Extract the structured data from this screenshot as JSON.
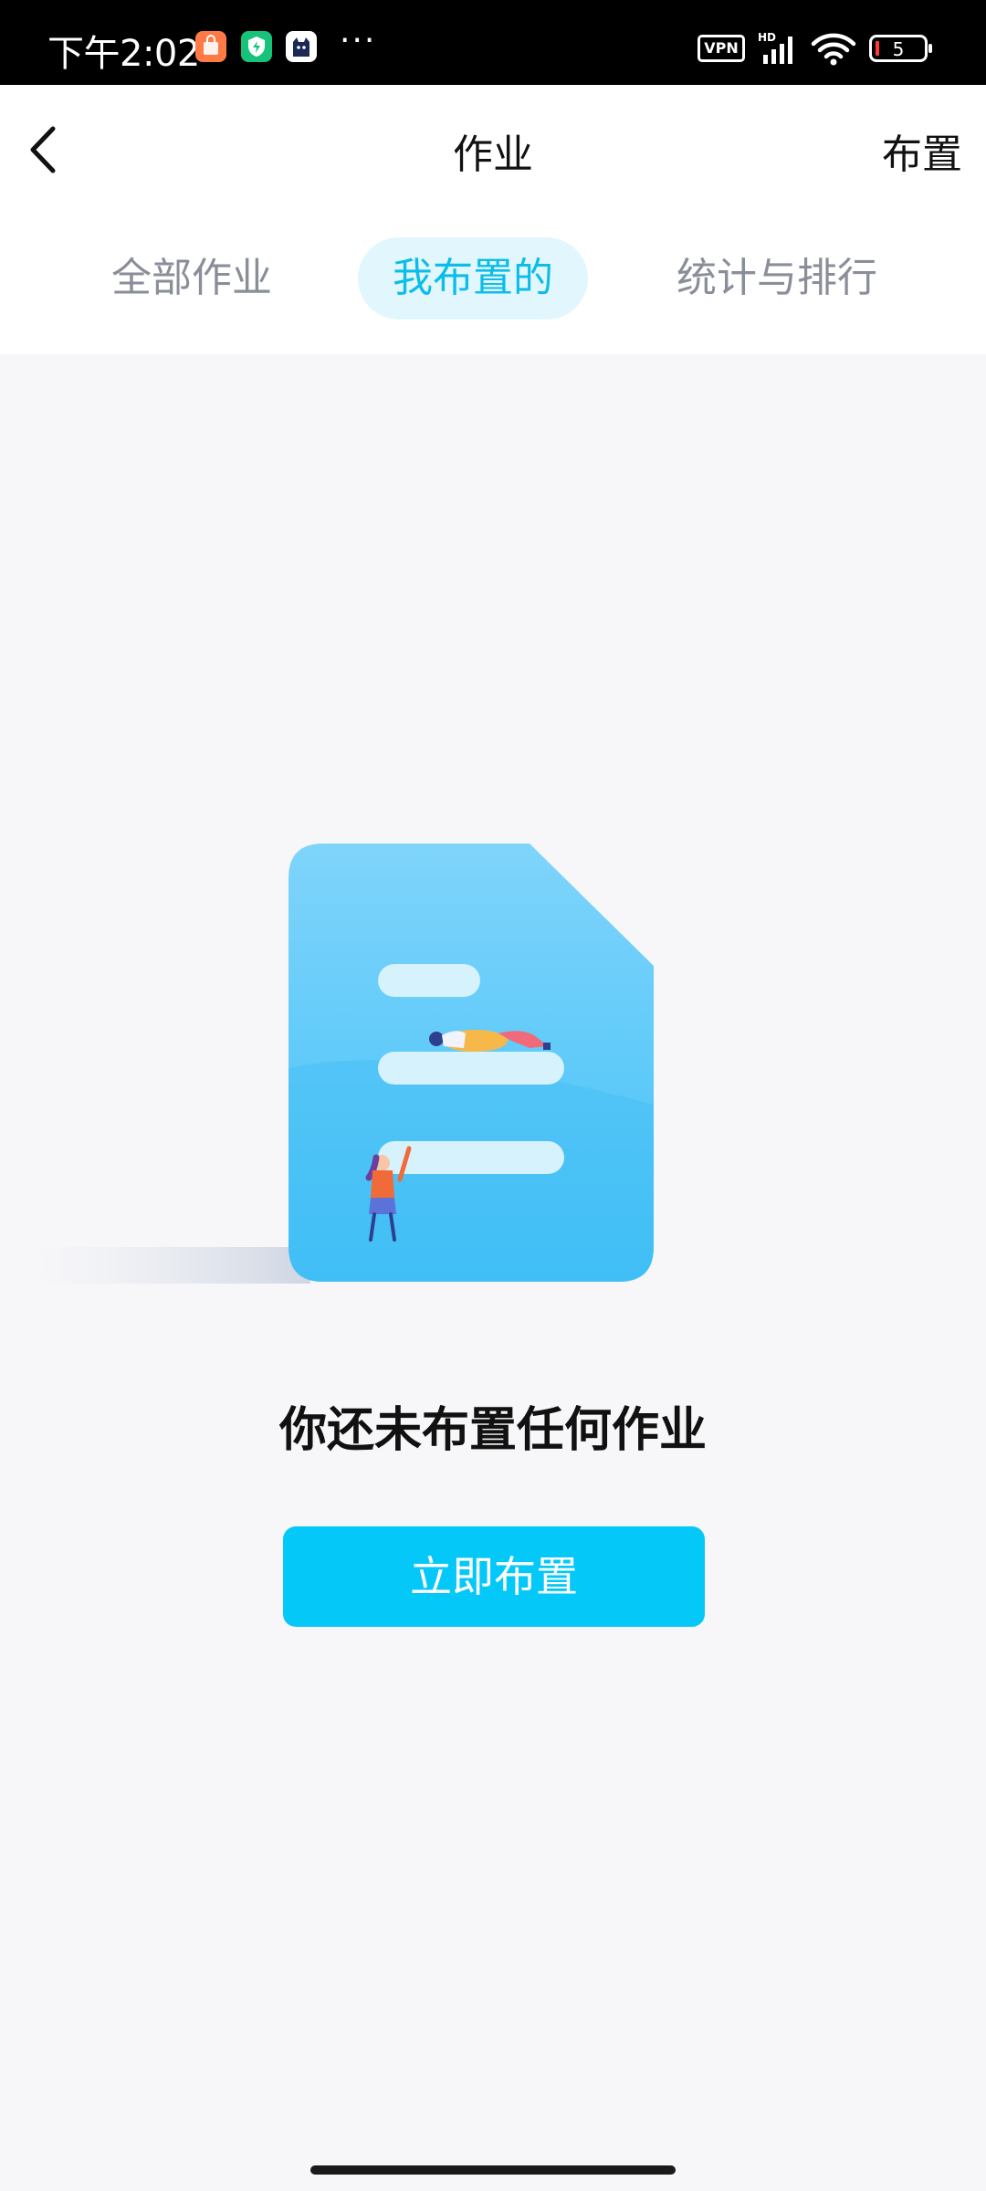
{
  "status_bar": {
    "time": "下午2:02",
    "vpn": "VPN",
    "network": "HD",
    "battery_level": "5",
    "overflow": "···",
    "apps": [
      {
        "icon": "shopping-bag-icon",
        "color": "#ff7a45"
      },
      {
        "icon": "shield-icon",
        "color": "#17c27a"
      },
      {
        "icon": "cat-icon",
        "color": "#ffffff"
      }
    ]
  },
  "header": {
    "title": "作业",
    "action": "布置",
    "back_icon": "chevron-left-icon"
  },
  "tabs": [
    {
      "label": "全部作业",
      "selected": false
    },
    {
      "label": "我布置的",
      "selected": true
    },
    {
      "label": "统计与排行",
      "selected": false
    }
  ],
  "empty_state": {
    "illustration": "document-with-people-illustration",
    "message": "你还未布置任何作业",
    "button": "立即布置"
  },
  "colors": {
    "accent": "#04c8f8",
    "tab_selected_text": "#0bbde8",
    "tab_selected_bg": "#e2f7fd",
    "page_bg": "#f7f7f9"
  }
}
